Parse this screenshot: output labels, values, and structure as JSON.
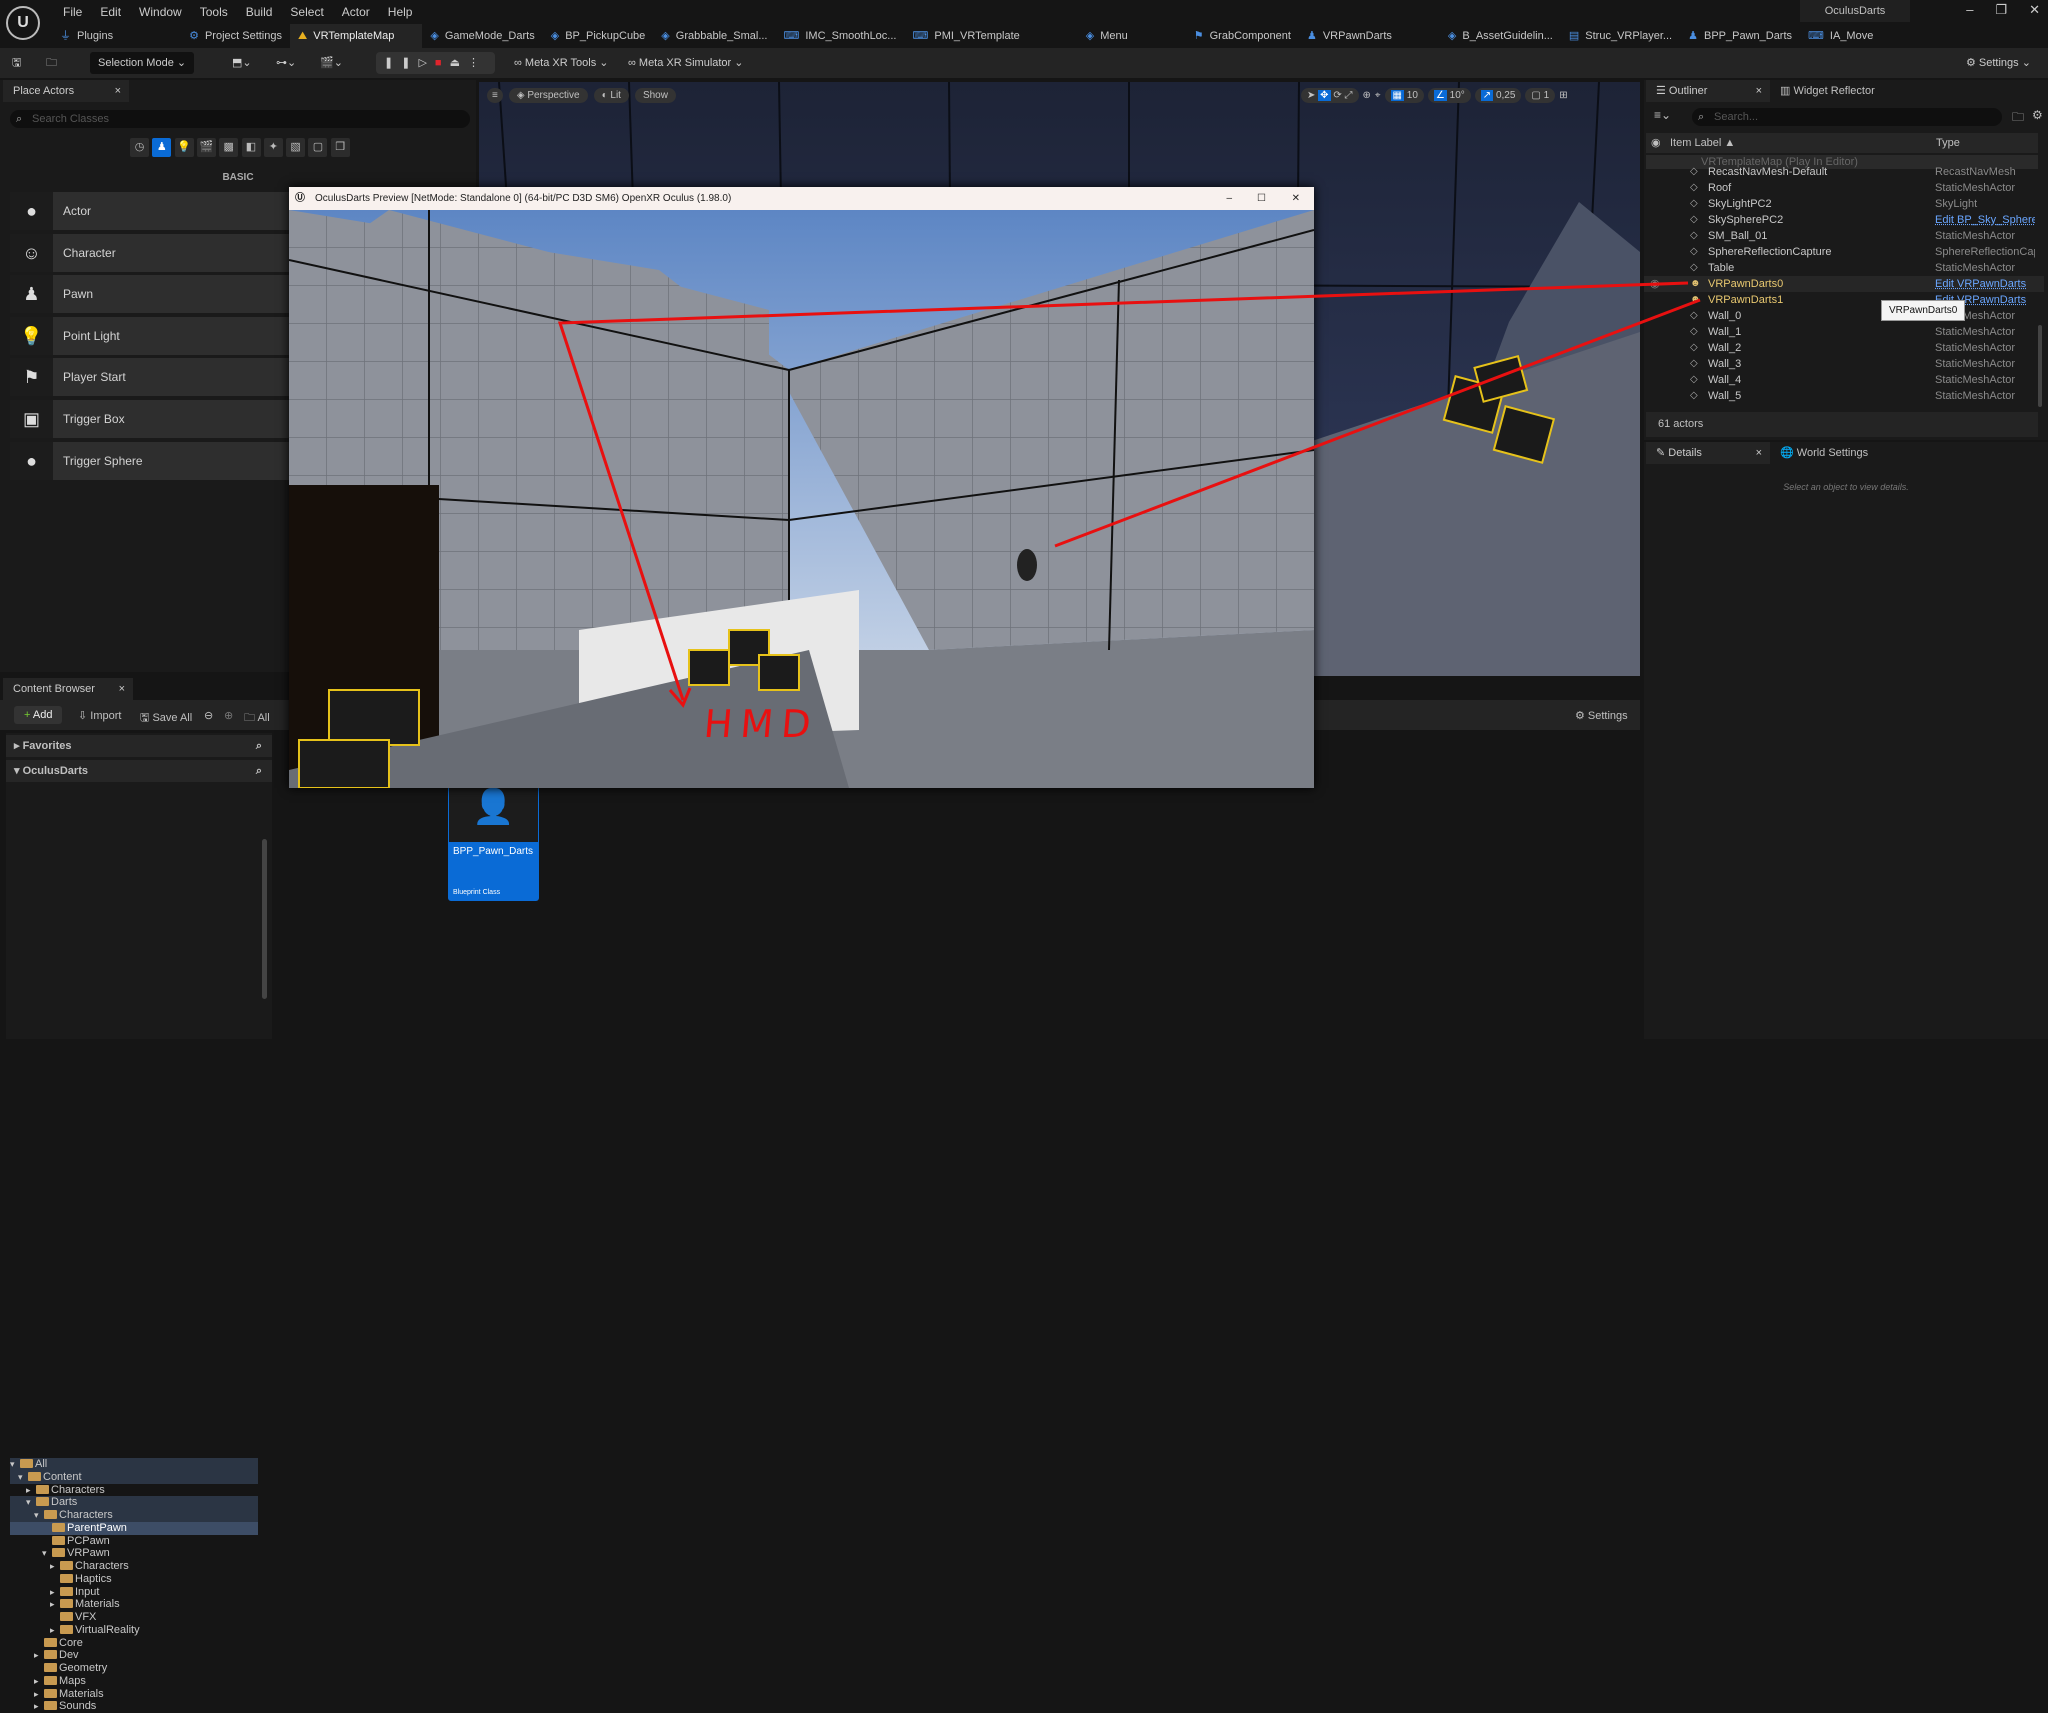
{
  "app": {
    "title": "OculusDarts",
    "logo": "UE"
  },
  "menu": [
    "File",
    "Edit",
    "Window",
    "Tools",
    "Build",
    "Select",
    "Actor",
    "Help"
  ],
  "tabs": [
    {
      "label": "Plugins",
      "icon": "plug-icon"
    },
    {
      "label": "Project Settings",
      "icon": "gear-icon"
    },
    {
      "label": "VRTemplateMap",
      "icon": "level-icon",
      "active": true
    },
    {
      "label": "GameMode_Darts",
      "icon": "blueprint-icon"
    },
    {
      "label": "BP_PickupCube",
      "icon": "blueprint-icon"
    },
    {
      "label": "Grabbable_Smal...",
      "icon": "blueprint-icon"
    },
    {
      "label": "IMC_SmoothLoc...",
      "icon": "input-icon"
    },
    {
      "label": "PMI_VRTemplate",
      "icon": "input-icon"
    },
    {
      "label": "Menu",
      "icon": "blueprint-icon"
    },
    {
      "label": "GrabComponent",
      "icon": "component-icon"
    },
    {
      "label": "VRPawnDarts",
      "icon": "pawn-icon"
    },
    {
      "label": "B_AssetGuidelin...",
      "icon": "blueprint-icon"
    },
    {
      "label": "Struc_VRPlayer...",
      "icon": "struct-icon"
    },
    {
      "label": "BPP_Pawn_Darts",
      "icon": "pawn-icon"
    },
    {
      "label": "IA_Move",
      "icon": "input-icon"
    }
  ],
  "toolbar": {
    "mode": "Selection Mode",
    "meta_tools": "Meta XR Tools",
    "meta_sim": "Meta XR Simulator",
    "settings": "Settings"
  },
  "place_actors": {
    "tab": "Place Actors",
    "search_placeholder": "Search Classes",
    "category": "BASIC",
    "items": [
      {
        "label": "Actor",
        "icon": "sphere-icon"
      },
      {
        "label": "Character",
        "icon": "character-icon"
      },
      {
        "label": "Pawn",
        "icon": "pawn-icon"
      },
      {
        "label": "Point Light",
        "icon": "lightbulb-icon"
      },
      {
        "label": "Player Start",
        "icon": "flag-gamepad-icon"
      },
      {
        "label": "Trigger Box",
        "icon": "box-icon"
      },
      {
        "label": "Trigger Sphere",
        "icon": "sphere-icon"
      }
    ]
  },
  "viewport": {
    "perspective": "Perspective",
    "lit": "Lit",
    "show": "Show",
    "grid": "10",
    "angle": "10°",
    "scale": "0,25",
    "cams": "1"
  },
  "pie": {
    "title": "OculusDarts Preview [NetMode: Standalone 0]  (64-bit/PC D3D SM6) OpenXR Oculus (1.98.0)",
    "annotation": "HMD",
    "annotation_color": "#e81010"
  },
  "outliner": {
    "tab": "Outliner",
    "tab2": "Widget Reflector",
    "search_placeholder": "Search...",
    "col_label": "Item Label ▲",
    "col_type": "Type",
    "root": "VRTemplateMap (Play In Editor)",
    "rows": [
      {
        "name": "RecastNavMesh-Default",
        "type": "RecastNavMesh"
      },
      {
        "name": "Roof",
        "type": "StaticMeshActor"
      },
      {
        "name": "SkyLightPC2",
        "type": "SkyLight"
      },
      {
        "name": "SkySpherePC2",
        "type": "Edit BP_Sky_Sphere",
        "link": true
      },
      {
        "name": "SM_Ball_01",
        "type": "StaticMeshActor"
      },
      {
        "name": "SphereReflectionCapture",
        "type": "SphereReflectionCapt"
      },
      {
        "name": "Table",
        "type": "StaticMeshActor"
      },
      {
        "name": "VRPawnDarts0",
        "type": "Edit VRPawnDarts",
        "link": true,
        "pawn": true
      },
      {
        "name": "VRPawnDarts1",
        "type": "Edit VRPawnDarts",
        "link": true,
        "pawn": true
      },
      {
        "name": "Wall_0",
        "type": "StaticMeshActor"
      },
      {
        "name": "Wall_1",
        "type": "StaticMeshActor"
      },
      {
        "name": "Wall_2",
        "type": "StaticMeshActor"
      },
      {
        "name": "Wall_3",
        "type": "StaticMeshActor"
      },
      {
        "name": "Wall_4",
        "type": "StaticMeshActor"
      },
      {
        "name": "Wall_5",
        "type": "StaticMeshActor"
      }
    ],
    "tooltip": "VRPawnDarts0",
    "count": "61 actors"
  },
  "details": {
    "tab": "Details",
    "tab2": "World Settings",
    "empty": "Select an object to view details."
  },
  "content_browser": {
    "tab": "Content Browser",
    "add": "Add",
    "import": "Import",
    "save_all": "Save All",
    "path": "All",
    "settings": "Settings",
    "favorites": "Favorites",
    "project": "OculusDarts",
    "tree": [
      {
        "label": "All",
        "d": 0,
        "s": "hl"
      },
      {
        "label": "Content",
        "d": 1,
        "s": "hl"
      },
      {
        "label": "Characters",
        "d": 2
      },
      {
        "label": "Darts",
        "d": 2,
        "s": "hl"
      },
      {
        "label": "Characters",
        "d": 3,
        "s": "hl"
      },
      {
        "label": "ParentPawn",
        "d": 4,
        "s": "sel"
      },
      {
        "label": "PCPawn",
        "d": 4
      },
      {
        "label": "VRPawn",
        "d": 4
      },
      {
        "label": "Characters",
        "d": 5
      },
      {
        "label": "Haptics",
        "d": 5
      },
      {
        "label": "Input",
        "d": 5
      },
      {
        "label": "Materials",
        "d": 5
      },
      {
        "label": "VFX",
        "d": 5
      },
      {
        "label": "VirtualReality",
        "d": 5
      },
      {
        "label": "Core",
        "d": 3
      },
      {
        "label": "Dev",
        "d": 3
      },
      {
        "label": "Geometry",
        "d": 3
      },
      {
        "label": "Maps",
        "d": 3
      },
      {
        "label": "Materials",
        "d": 3
      },
      {
        "label": "Sounds",
        "d": 3
      }
    ],
    "asset": {
      "name": "BPP_Pawn_Darts",
      "type": "Blueprint Class"
    }
  }
}
